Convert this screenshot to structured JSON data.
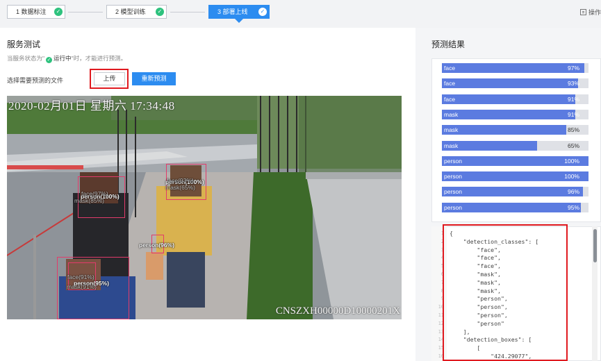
{
  "steps": [
    {
      "label": "1 数据标注",
      "done": true
    },
    {
      "label": "2 模型训练",
      "done": true
    },
    {
      "label": "3 部署上线",
      "done": true,
      "active": true
    }
  ],
  "top_action": {
    "label": "操作",
    "icon": "document-icon"
  },
  "service_test": {
    "title": "服务测试",
    "hint_prefix": "当服务状态为\"",
    "hint_status": "运行中",
    "hint_suffix": "\"时，才能进行预测。",
    "file_label": "选择需要预测的文件",
    "upload_label": "上传",
    "repredict_label": "重新预测"
  },
  "image": {
    "timestamp": "2020-02月01日 星期六 17:34:48",
    "camera_id": "CNSZXH00000D10000201X",
    "detections": [
      {
        "label": "person(100%)",
        "faint": false
      },
      {
        "label": "person(100%)",
        "faint": false
      },
      {
        "label": "person(96%)",
        "faint": false
      },
      {
        "label": "person(95%)",
        "faint": false
      },
      {
        "label": "face(97%)",
        "faint": true
      },
      {
        "label": "mask(85%)",
        "faint": true
      },
      {
        "label": "face(93%)",
        "faint": true
      },
      {
        "label": "mask(65%)",
        "faint": true
      },
      {
        "label": "face(91%)",
        "faint": true
      },
      {
        "label": "mask(91%)",
        "faint": true
      }
    ]
  },
  "results": {
    "title": "预测结果",
    "bars": [
      {
        "label": "face",
        "value": 0.97,
        "text": "97%"
      },
      {
        "label": "face",
        "value": 0.93,
        "text": "93%"
      },
      {
        "label": "face",
        "value": 0.91,
        "text": "91%"
      },
      {
        "label": "mask",
        "value": 0.91,
        "text": "91%"
      },
      {
        "label": "mask",
        "value": 0.85,
        "text": "85%"
      },
      {
        "label": "mask",
        "value": 0.65,
        "text": "65%"
      },
      {
        "label": "person",
        "value": 1.0,
        "text": "100%"
      },
      {
        "label": "person",
        "value": 1.0,
        "text": "100%"
      },
      {
        "label": "person",
        "value": 0.96,
        "text": "96%"
      },
      {
        "label": "person",
        "value": 0.95,
        "text": "95%"
      }
    ],
    "bar_color": "#5b7be0",
    "bar_track_color": "#dfe1e6"
  },
  "json_output": {
    "lines": [
      "{",
      "    \"detection_classes\": [",
      "        \"face\",",
      "        \"face\",",
      "        \"face\",",
      "        \"mask\",",
      "        \"mask\",",
      "        \"mask\",",
      "        \"person\",",
      "        \"person\",",
      "        \"person\",",
      "        \"person\"",
      "    ],",
      "    \"detection_boxes\": [",
      "        [",
      "            \"424.29077\","
    ]
  },
  "colors": {
    "accent": "#2c8cf0",
    "success": "#2ec27e",
    "highlight": "#e0191f",
    "box": "#e23b6b"
  }
}
